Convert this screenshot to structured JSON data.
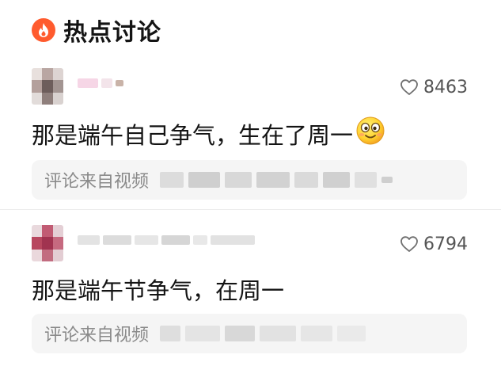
{
  "section": {
    "title": "热点讨论",
    "icon": "flame-icon",
    "accent_color": "#ff5b2e"
  },
  "comments": [
    {
      "avatar_icon": "pixelated-avatar",
      "like_count": "8463",
      "like_icon": "heart-outline-icon",
      "text": "那是端午自己争气，生在了周一",
      "emoji": "smiley-emoji",
      "source_label": "评论来自视频"
    },
    {
      "avatar_icon": "pixelated-avatar",
      "like_count": "6794",
      "like_icon": "heart-outline-icon",
      "text": "那是端午节争气，在周一",
      "source_label": "评论来自视频"
    }
  ]
}
